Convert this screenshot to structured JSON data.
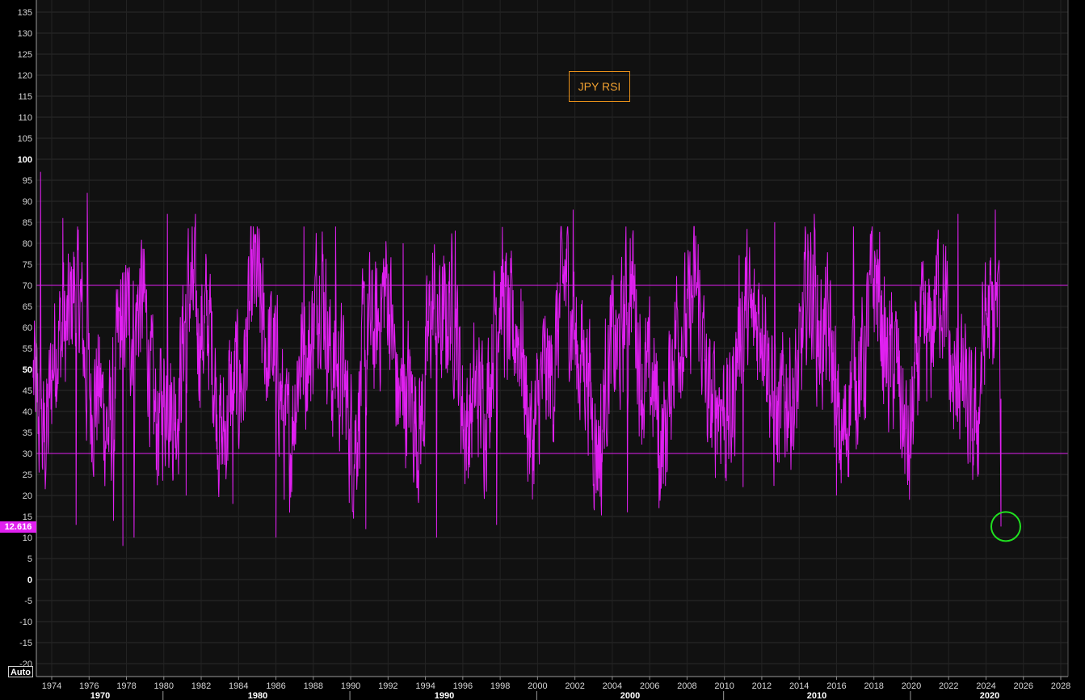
{
  "chart_data": {
    "type": "line",
    "title": "JPY RSI",
    "series": [
      {
        "name": "JPY RSI",
        "color": "#e020f0",
        "last_value": 12.616,
        "sample_points": [
          {
            "x": 1973.0,
            "y": 48
          },
          {
            "x": 1973.4,
            "y": 97
          },
          {
            "x": 1973.8,
            "y": 30
          },
          {
            "x": 1974.6,
            "y": 86
          },
          {
            "x": 1975.3,
            "y": 13
          },
          {
            "x": 1975.9,
            "y": 92
          },
          {
            "x": 1977.3,
            "y": 14
          },
          {
            "x": 1977.8,
            "y": 8
          },
          {
            "x": 1978.4,
            "y": 10
          },
          {
            "x": 1980.2,
            "y": 87
          },
          {
            "x": 1981.2,
            "y": 20
          },
          {
            "x": 1981.7,
            "y": 87
          },
          {
            "x": 1983.7,
            "y": 18
          },
          {
            "x": 1986.0,
            "y": 10
          },
          {
            "x": 1987.5,
            "y": 84
          },
          {
            "x": 1989.2,
            "y": 84
          },
          {
            "x": 1990.8,
            "y": 12
          },
          {
            "x": 1992.8,
            "y": 80
          },
          {
            "x": 1994.6,
            "y": 10
          },
          {
            "x": 1995.6,
            "y": 83
          },
          {
            "x": 1997.8,
            "y": 13
          },
          {
            "x": 2001.9,
            "y": 88
          },
          {
            "x": 2003.4,
            "y": 18
          },
          {
            "x": 2004.8,
            "y": 16
          },
          {
            "x": 2006.5,
            "y": 17
          },
          {
            "x": 2011.0,
            "y": 22
          },
          {
            "x": 2012.7,
            "y": 85
          },
          {
            "x": 2014.8,
            "y": 87
          },
          {
            "x": 2016.0,
            "y": 20
          },
          {
            "x": 2016.9,
            "y": 84
          },
          {
            "x": 2019.9,
            "y": 19
          },
          {
            "x": 2022.5,
            "y": 87
          },
          {
            "x": 2023.6,
            "y": 25
          },
          {
            "x": 2024.5,
            "y": 88
          },
          {
            "x": 2024.7,
            "y": 76
          },
          {
            "x": 2024.8,
            "y": 12.616
          }
        ]
      }
    ],
    "reference_lines": [
      70,
      30
    ],
    "ylim": [
      -22,
      138
    ],
    "yticks": [
      135,
      130,
      125,
      120,
      115,
      110,
      105,
      100,
      95,
      90,
      85,
      80,
      75,
      70,
      65,
      60,
      55,
      50,
      45,
      40,
      35,
      30,
      25,
      20,
      15,
      10,
      5,
      0,
      -5,
      -10,
      -15,
      -20
    ],
    "ytick_labels": [
      "135",
      "130",
      "125",
      "120",
      "115",
      "110",
      "105",
      "100",
      "95",
      "90",
      "85",
      "80",
      "75",
      "70",
      "65",
      "60",
      "55",
      "50",
      "45",
      "40",
      "35",
      "30",
      "25",
      "20",
      "15",
      "10",
      "5",
      "0",
      "-5",
      "-10",
      "-15",
      "-20"
    ],
    "xlim": [
      1972.7,
      2028.8
    ],
    "xticks": [
      1974,
      1976,
      1978,
      1980,
      1982,
      1984,
      1986,
      1988,
      1990,
      1992,
      1994,
      1996,
      1998,
      2000,
      2002,
      2004,
      2006,
      2008,
      2010,
      2012,
      2014,
      2016,
      2018,
      2020,
      2022,
      2024,
      2026,
      2028
    ],
    "xtick_labels": [
      "1974",
      "1976",
      "1978",
      "1980",
      "1982",
      "1984",
      "1986",
      "1988",
      "1990",
      "1992",
      "1994",
      "1996",
      "1998",
      "2000",
      "2002",
      "2004",
      "2006",
      "2008",
      "2010",
      "2012",
      "2014",
      "2016",
      "2018",
      "2020",
      "2022",
      "2024",
      "2026",
      "2028"
    ],
    "decade_labels": [
      "1970",
      "1980",
      "1990",
      "2000",
      "2010",
      "2020"
    ],
    "decade_boundaries": [
      1980,
      1990,
      2000,
      2010,
      2020
    ],
    "grid": true,
    "legend_position": "top-center",
    "highlight": {
      "shape": "circle",
      "color": "#20e020",
      "x": 2024.8,
      "y": 12.616
    }
  },
  "ui": {
    "last_value_badge": "12.616",
    "auto_button": "Auto",
    "background": "#000000",
    "plot_background": "#111111"
  }
}
